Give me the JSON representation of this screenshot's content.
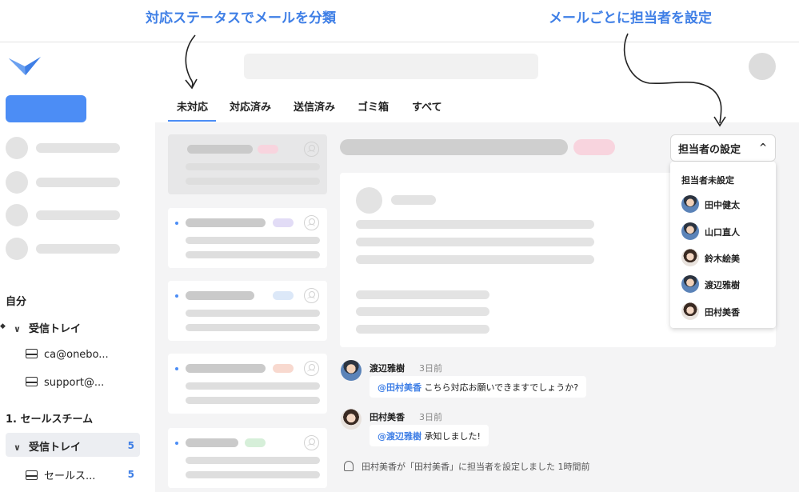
{
  "captions": {
    "left": "対応ステータスでメールを分類",
    "right": "メールごとに担当者を設定"
  },
  "tabs": [
    {
      "label": "未対応",
      "active": true
    },
    {
      "label": "対応済み"
    },
    {
      "label": "送信済み"
    },
    {
      "label": "ゴミ箱"
    },
    {
      "label": "すべて"
    }
  ],
  "sidebar": {
    "section_self": "自分",
    "inbox_label": "受信トレイ",
    "accounts": [
      "ca@onebo...",
      "support@..."
    ],
    "section_team": "1. セールスチーム",
    "team_inbox_label": "受信トレイ",
    "team_inbox_count": "5",
    "team_account": "セールス...",
    "team_account_count": "5"
  },
  "assignee": {
    "button_label": "担当者の設定",
    "caret": "^",
    "unassigned_label": "担当者未設定",
    "options": [
      {
        "name": "田中健太",
        "avatar": "male"
      },
      {
        "name": "山口直人",
        "avatar": "male"
      },
      {
        "name": "鈴木絵美",
        "avatar": "female"
      },
      {
        "name": "渡辺雅樹",
        "avatar": "male"
      },
      {
        "name": "田村美香",
        "avatar": "female"
      }
    ]
  },
  "comments": [
    {
      "author": "渡辺雅樹",
      "time": "3日前",
      "mention": "@田村美香",
      "text": "こちら対応お願いできますでしょうか?"
    },
    {
      "author": "田村美香",
      "time": "3日前",
      "mention": "@渡辺雅樹",
      "text": "承知しました!"
    }
  ],
  "activity": "田村美香が「田村美香」に担当者を設定しました 1時間前",
  "colors": {
    "accent": "#4c8df5",
    "chip_pink": "#f8d4de",
    "chip_purple": "#e2dcf6",
    "chip_blue": "#dce8f8",
    "chip_orange": "#f8d9cf",
    "chip_green": "#d6efd9"
  }
}
